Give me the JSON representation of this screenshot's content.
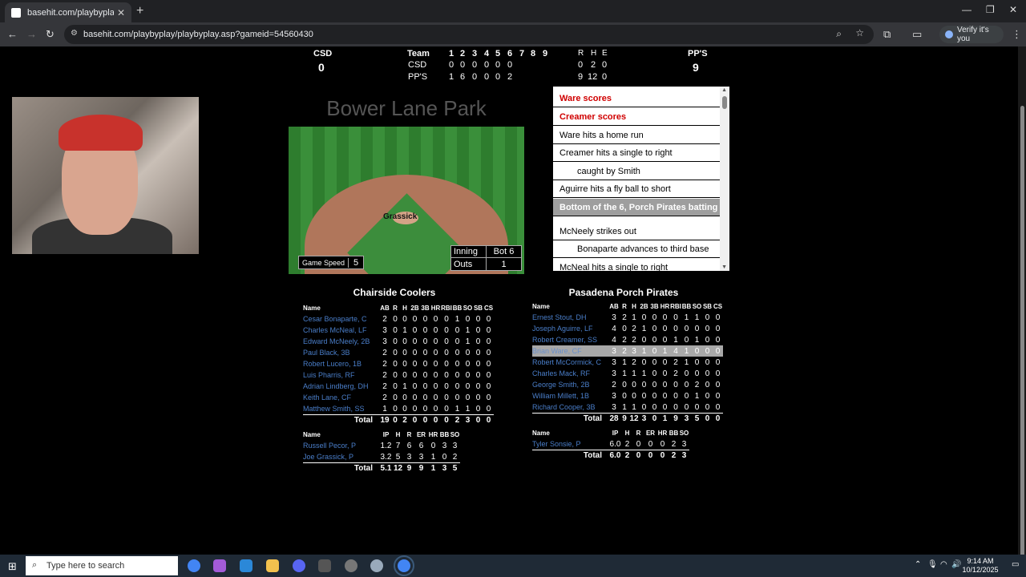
{
  "browser": {
    "tab_title": "basehit.com/playbyplay/playb",
    "url": "basehit.com/playbyplay/playbyplay.asp?gameid=54560430",
    "verify_label": "Verify it's you"
  },
  "scoreboard": {
    "away_abbr": "CSD",
    "away_score": "0",
    "home_abbr": "PP'S",
    "home_score": "9",
    "header_team": "Team",
    "innings": [
      "1",
      "2",
      "3",
      "4",
      "5",
      "6",
      "7",
      "8",
      "9"
    ],
    "rhe_labels": [
      "R",
      "H",
      "E"
    ],
    "rows": [
      {
        "team": "CSD",
        "innings": [
          "0",
          "0",
          "0",
          "0",
          "0",
          "0"
        ],
        "rhe": [
          "0",
          "2",
          "0"
        ]
      },
      {
        "team": "PP'S",
        "innings": [
          "1",
          "6",
          "0",
          "0",
          "0",
          "2"
        ],
        "rhe": [
          "9",
          "12",
          "0"
        ]
      }
    ]
  },
  "field": {
    "park_name": "Bower Lane Park",
    "pitcher": "Grassick",
    "game_speed_label": "Game Speed",
    "game_speed": "5",
    "inning_label": "Inning",
    "inning_value": "Bot 6",
    "outs_label": "Outs",
    "outs_value": "1"
  },
  "play_by_play": [
    {
      "text": "Ware scores",
      "style": "red"
    },
    {
      "text": "Creamer scores",
      "style": "red"
    },
    {
      "text": "Ware hits a home run",
      "style": "normal"
    },
    {
      "text": "Creamer hits a single to right",
      "style": "normal"
    },
    {
      "text": "caught by Smith",
      "style": "indent"
    },
    {
      "text": "Aguirre hits a fly ball to short",
      "style": "normal"
    },
    {
      "text": "Bottom of the 6, Porch Pirates batting",
      "style": "highlight"
    },
    {
      "text": "McNeely strikes out",
      "style": "normal"
    },
    {
      "text": "Bonaparte advances to third base",
      "style": "indent"
    },
    {
      "text": "McNeal hits a single to right",
      "style": "normal"
    }
  ],
  "away_box": {
    "team_name": "Chairside Coolers",
    "bat_headers": [
      "Name",
      "AB",
      "R",
      "H",
      "2B",
      "3B",
      "HR",
      "RBI",
      "BB",
      "SO",
      "SB",
      "CS"
    ],
    "batters": [
      {
        "name": "Cesar Bonaparte, C",
        "stats": [
          "2",
          "0",
          "0",
          "0",
          "0",
          "0",
          "0",
          "1",
          "0",
          "0",
          "0"
        ]
      },
      {
        "name": "Charles McNeal, LF",
        "stats": [
          "3",
          "0",
          "1",
          "0",
          "0",
          "0",
          "0",
          "0",
          "1",
          "0",
          "0"
        ]
      },
      {
        "name": "Edward McNeely, 2B",
        "stats": [
          "3",
          "0",
          "0",
          "0",
          "0",
          "0",
          "0",
          "0",
          "1",
          "0",
          "0"
        ]
      },
      {
        "name": "Paul Black, 3B",
        "stats": [
          "2",
          "0",
          "0",
          "0",
          "0",
          "0",
          "0",
          "0",
          "0",
          "0",
          "0"
        ]
      },
      {
        "name": "Robert Lucero, 1B",
        "stats": [
          "2",
          "0",
          "0",
          "0",
          "0",
          "0",
          "0",
          "0",
          "0",
          "0",
          "0"
        ]
      },
      {
        "name": "Luis Pharris, RF",
        "stats": [
          "2",
          "0",
          "0",
          "0",
          "0",
          "0",
          "0",
          "0",
          "0",
          "0",
          "0"
        ]
      },
      {
        "name": "Adrian Lindberg, DH",
        "stats": [
          "2",
          "0",
          "1",
          "0",
          "0",
          "0",
          "0",
          "0",
          "0",
          "0",
          "0"
        ]
      },
      {
        "name": "Keith Lane, CF",
        "stats": [
          "2",
          "0",
          "0",
          "0",
          "0",
          "0",
          "0",
          "0",
          "0",
          "0",
          "0"
        ]
      },
      {
        "name": "Matthew Smith, SS",
        "stats": [
          "1",
          "0",
          "0",
          "0",
          "0",
          "0",
          "0",
          "1",
          "1",
          "0",
          "0"
        ]
      }
    ],
    "bat_total_label": "Total",
    "bat_totals": [
      "19",
      "0",
      "2",
      "0",
      "0",
      "0",
      "0",
      "2",
      "3",
      "0",
      "0"
    ],
    "pitch_headers": [
      "Name",
      "IP",
      "H",
      "R",
      "ER",
      "HR",
      "BB",
      "SO"
    ],
    "pitchers": [
      {
        "name": "Russell Pecor, P",
        "stats": [
          "1.2",
          "7",
          "6",
          "6",
          "0",
          "3",
          "3"
        ]
      },
      {
        "name": "Joe Grassick, P",
        "stats": [
          "3.2",
          "5",
          "3",
          "3",
          "1",
          "0",
          "2"
        ]
      }
    ],
    "pitch_total_label": "Total",
    "pitch_totals": [
      "5.1",
      "12",
      "9",
      "9",
      "1",
      "3",
      "5"
    ]
  },
  "home_box": {
    "team_name": "Pasadena Porch Pirates",
    "bat_headers": [
      "Name",
      "AB",
      "R",
      "H",
      "2B",
      "3B",
      "HR",
      "RBI",
      "BB",
      "SO",
      "SB",
      "CS"
    ],
    "batters": [
      {
        "name": "Ernest Stout, DH",
        "stats": [
          "3",
          "2",
          "1",
          "0",
          "0",
          "0",
          "0",
          "1",
          "1",
          "0",
          "0"
        ]
      },
      {
        "name": "Joseph Aguirre, LF",
        "stats": [
          "4",
          "0",
          "2",
          "1",
          "0",
          "0",
          "0",
          "0",
          "0",
          "0",
          "0"
        ]
      },
      {
        "name": "Robert Creamer, SS",
        "stats": [
          "4",
          "2",
          "2",
          "0",
          "0",
          "0",
          "1",
          "0",
          "1",
          "0",
          "0"
        ]
      },
      {
        "name": "Brian Ware, CF",
        "stats": [
          "3",
          "2",
          "3",
          "1",
          "0",
          "1",
          "4",
          "1",
          "0",
          "0",
          "0"
        ],
        "highlight": true
      },
      {
        "name": "Robert McCormick, C",
        "stats": [
          "3",
          "1",
          "2",
          "0",
          "0",
          "0",
          "2",
          "1",
          "0",
          "0",
          "0"
        ]
      },
      {
        "name": "Charles Mack, RF",
        "stats": [
          "3",
          "1",
          "1",
          "1",
          "0",
          "0",
          "2",
          "0",
          "0",
          "0",
          "0"
        ]
      },
      {
        "name": "George Smith, 2B",
        "stats": [
          "2",
          "0",
          "0",
          "0",
          "0",
          "0",
          "0",
          "0",
          "2",
          "0",
          "0"
        ]
      },
      {
        "name": "William Millett, 1B",
        "stats": [
          "3",
          "0",
          "0",
          "0",
          "0",
          "0",
          "0",
          "0",
          "1",
          "0",
          "0"
        ]
      },
      {
        "name": "Richard Cooper, 3B",
        "stats": [
          "3",
          "1",
          "1",
          "0",
          "0",
          "0",
          "0",
          "0",
          "0",
          "0",
          "0"
        ]
      }
    ],
    "bat_total_label": "Total",
    "bat_totals": [
      "28",
      "9",
      "12",
      "3",
      "0",
      "1",
      "9",
      "3",
      "5",
      "0",
      "0"
    ],
    "pitch_headers": [
      "Name",
      "IP",
      "H",
      "R",
      "ER",
      "HR",
      "BB",
      "SO"
    ],
    "pitchers": [
      {
        "name": "Tyler Sonsie, P",
        "stats": [
          "6.0",
          "2",
          "0",
          "0",
          "0",
          "2",
          "3"
        ]
      }
    ],
    "pitch_total_label": "Total",
    "pitch_totals": [
      "6.0",
      "2",
      "0",
      "0",
      "0",
      "2",
      "3"
    ]
  },
  "taskbar": {
    "search_placeholder": "Type here to search",
    "time": "9:14 AM",
    "date": "10/12/2025"
  }
}
